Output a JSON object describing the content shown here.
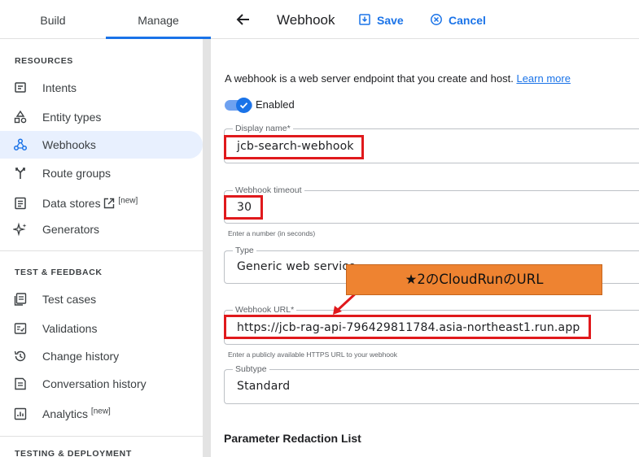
{
  "nav_tabs": {
    "build": "Build",
    "manage": "Manage"
  },
  "sidebar": {
    "resources_header": "RESOURCES",
    "resources": [
      {
        "label": "Intents",
        "icon": "intents-icon"
      },
      {
        "label": "Entity types",
        "icon": "entity-types-icon"
      },
      {
        "label": "Webhooks",
        "icon": "webhooks-icon",
        "active": true
      },
      {
        "label": "Route groups",
        "icon": "route-groups-icon"
      },
      {
        "label": "Data stores",
        "icon": "data-stores-icon",
        "badge": "[new]"
      },
      {
        "label": "Generators",
        "icon": "generators-icon"
      }
    ],
    "test_header": "TEST & FEEDBACK",
    "test": [
      {
        "label": "Test cases",
        "icon": "test-cases-icon"
      },
      {
        "label": "Validations",
        "icon": "validations-icon"
      },
      {
        "label": "Change history",
        "icon": "history-icon"
      },
      {
        "label": "Conversation history",
        "icon": "conversation-history-icon"
      },
      {
        "label": "Analytics",
        "icon": "analytics-icon",
        "badge": "[new]"
      }
    ],
    "deploy_header": "TESTING & DEPLOYMENT"
  },
  "header": {
    "title": "Webhook",
    "save": "Save",
    "cancel": "Cancel"
  },
  "form": {
    "description": "A webhook is a web server endpoint that you create and host.",
    "learn_more": "Learn more",
    "enabled_label": "Enabled",
    "enabled": true,
    "display_name": {
      "label": "Display name*",
      "value": "jcb-search-webhook"
    },
    "timeout": {
      "label": "Webhook timeout",
      "value": "30",
      "hint": "Enter a number (in seconds)"
    },
    "type": {
      "label": "Type",
      "value": "Generic web service"
    },
    "url": {
      "label": "Webhook URL*",
      "value": "https://jcb-rag-api-796429811784.asia-northeast1.run.app",
      "hint": "Enter a publicly available HTTPS URL to your webhook"
    },
    "subtype": {
      "label": "Subtype",
      "value": "Standard"
    },
    "parameter_redaction_title": "Parameter Redaction List"
  },
  "annotation": {
    "callout": "★2のCloudRunのURL",
    "highlight_color": "#e0191c",
    "callout_color": "#ee8331"
  },
  "colors": {
    "accent": "#1a73e8",
    "active_bg": "#e8f0fe"
  }
}
